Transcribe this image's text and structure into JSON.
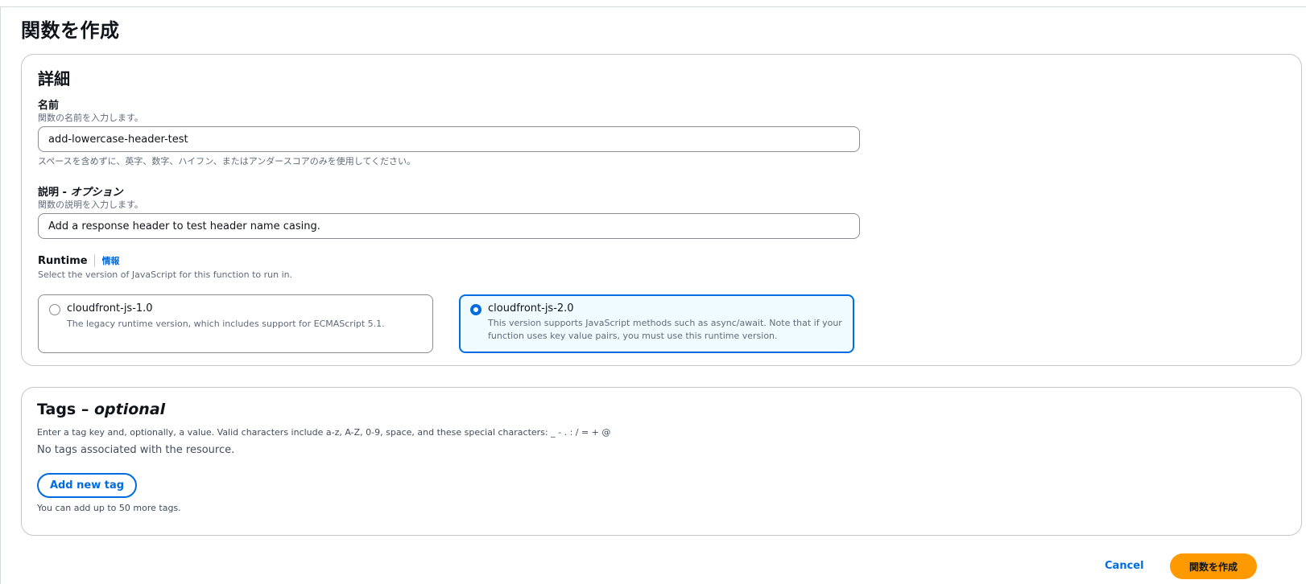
{
  "page": {
    "title": "関数を作成"
  },
  "details": {
    "title": "詳細",
    "name": {
      "label": "名前",
      "description": "関数の名前を入力します。",
      "value": "add-lowercase-header-test",
      "constraint": "スペースを含めずに、英字、数字、ハイフン、またはアンダースコアのみを使用してください。"
    },
    "description": {
      "label": "説明 - ",
      "label_optional": "オプション",
      "description": "関数の説明を入力します。",
      "value": "Add a response header to test header name casing."
    },
    "runtime": {
      "label": "Runtime",
      "info": "情報",
      "description": "Select the version of JavaScript for this function to run in.",
      "options": [
        {
          "title": "cloudfront-js-1.0",
          "description": "The legacy runtime version, which includes support for ECMAScript 5.1.",
          "selected": false
        },
        {
          "title": "cloudfront-js-2.0",
          "description": "This version supports JavaScript methods such as async/await. Note that if your function uses key value pairs, you must use this runtime version.",
          "selected": true
        }
      ]
    }
  },
  "tags": {
    "title": "Tags – ",
    "title_optional": "optional",
    "hint": "Enter a tag key and, optionally, a value. Valid characters include a-z, A-Z, 0-9, space, and these special characters: _ - . : / = + @",
    "empty": "No tags associated with the resource.",
    "add_button": "Add new tag",
    "limit": "You can add up to 50 more tags."
  },
  "footer": {
    "cancel": "Cancel",
    "create": "関数を作成"
  },
  "colors": {
    "accent": "#006ce0",
    "primary_button": "#ff9900",
    "selected_tile_bg": "#f0fbff"
  }
}
